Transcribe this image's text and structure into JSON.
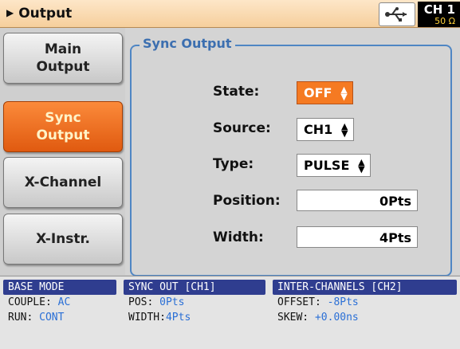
{
  "header": {
    "arrow": "▶",
    "title": "Output",
    "usb_icon": "usb-icon",
    "channel": "CH 1",
    "impedance": "50 Ω"
  },
  "side_buttons": [
    {
      "label_line1": "Main",
      "label_line2": "Output",
      "active": false
    },
    {
      "label_line1": "Sync",
      "label_line2": "Output",
      "active": true
    },
    {
      "label_line1": "X-Channel",
      "label_line2": "",
      "active": false
    },
    {
      "label_line1": "X-Instr.",
      "label_line2": "",
      "active": false
    }
  ],
  "sync_output": {
    "group_title": "Sync Output",
    "state": {
      "label": "State:",
      "value": "OFF"
    },
    "source": {
      "label": "Source:",
      "value": "CH1"
    },
    "type": {
      "label": "Type:",
      "value": "PULSE"
    },
    "position": {
      "label": "Position:",
      "value": "0Pts"
    },
    "width": {
      "label": "Width:",
      "value": "4Pts"
    },
    "updown_glyph": "▲▼"
  },
  "status": {
    "base_mode": {
      "title": "BASE MODE",
      "couple_label": "COUPLE:",
      "couple_value": "AC",
      "run_label": "RUN:",
      "run_value": "CONT"
    },
    "sync_out": {
      "title": "SYNC OUT [CH1]",
      "pos_label": "POS:",
      "pos_value": "0Pts",
      "width_label": "WIDTH:",
      "width_value": "4Pts"
    },
    "inter_channels": {
      "title": "INTER-CHANNELS [CH2]",
      "offset_label": "OFFSET:",
      "offset_value": "-8Pts",
      "skew_label": "SKEW:",
      "skew_value": "+0.00ns"
    }
  },
  "colors": {
    "accent_orange": "#f57a22",
    "group_blue": "#4f86c4",
    "status_header": "#2f3d8f",
    "value_blue": "#2a6fd6"
  }
}
